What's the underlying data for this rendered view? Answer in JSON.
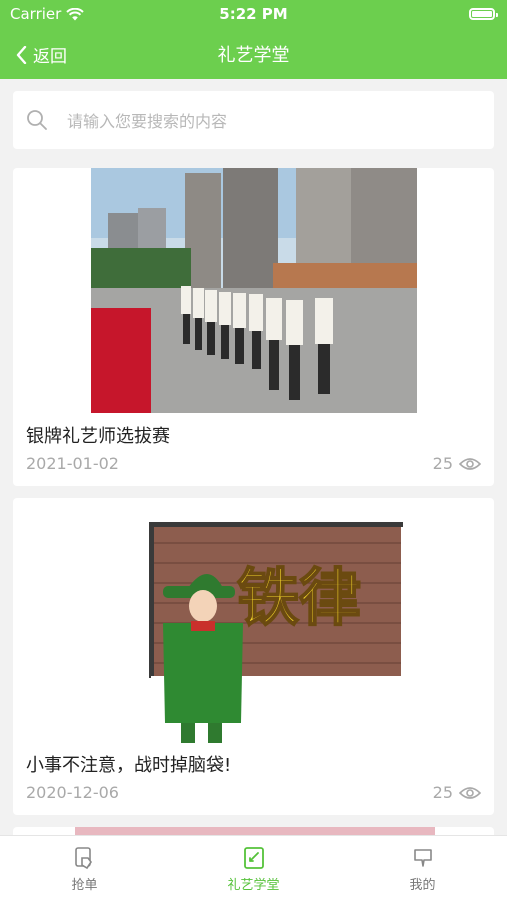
{
  "status": {
    "carrier": "Carrier",
    "time": "5:22 PM"
  },
  "nav": {
    "back_label": "返回",
    "title": "礼艺学堂"
  },
  "search": {
    "placeholder": "请输入您要搜索的内容"
  },
  "articles": [
    {
      "title": "银牌礼艺师选拔赛",
      "date": "2021-01-02",
      "views": "25"
    },
    {
      "title": "小事不注意，战时掉脑袋!",
      "date": "2020-12-06",
      "views": "25"
    }
  ],
  "poster": {
    "headline": "铁律"
  },
  "tabs": [
    {
      "label": "抢单",
      "icon": "grab-order-icon"
    },
    {
      "label": "礼艺学堂",
      "icon": "school-icon"
    },
    {
      "label": "我的",
      "icon": "profile-icon"
    }
  ],
  "colors": {
    "primary": "#6ccf4e",
    "tab_active": "#55c23a"
  }
}
